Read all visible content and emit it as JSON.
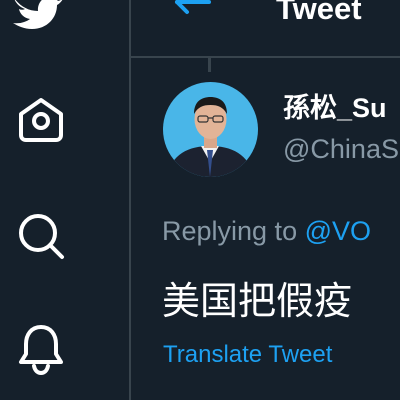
{
  "colors": {
    "background": "#15202b",
    "border": "#38444d",
    "accent": "#1da1f2",
    "text_primary": "#ffffff",
    "text_secondary": "#8899a6"
  },
  "sidebar": {
    "items": [
      {
        "icon": "twitter-bird-icon"
      },
      {
        "icon": "home-icon"
      },
      {
        "icon": "search-icon"
      },
      {
        "icon": "bell-icon"
      }
    ]
  },
  "header": {
    "back_icon": "back-arrow-icon",
    "title": "Tweet"
  },
  "tweet": {
    "author_name": "孫松_Su",
    "author_handle": "@ChinaS",
    "replying_prefix": "Replying to ",
    "replying_mention": "@VO",
    "text": "美国把假疫",
    "translate_label": "Translate Tweet"
  }
}
